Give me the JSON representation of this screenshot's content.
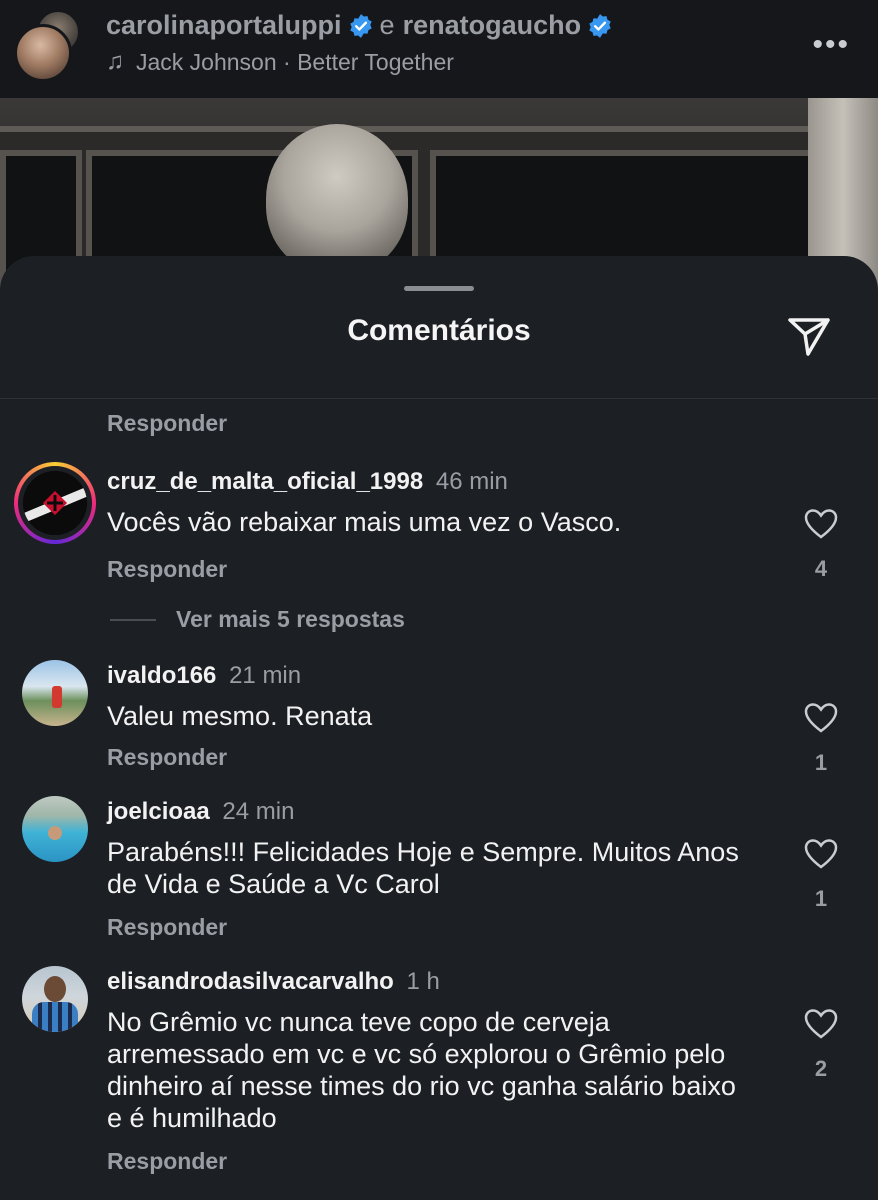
{
  "post_header": {
    "user1": "carolinaportaluppi",
    "connector": "e",
    "user2": "renatogaucho",
    "music": "Jack Johnson · Better Together",
    "more_icon": "more-horizontal-icon"
  },
  "sheet": {
    "title": "Comentários",
    "share_icon": "send-icon",
    "reply_label": "Responder"
  },
  "comments": [
    {
      "username": "cruz_de_malta_oficial_1998",
      "time": "46 min",
      "text": "Vocês vão rebaixar mais uma vez o Vasco.",
      "likes": "4",
      "reply": "Responder",
      "more_replies": "Ver mais 5 respostas"
    },
    {
      "username": "ivaldo166",
      "time": "21 min",
      "text": "Valeu mesmo.  Renata",
      "likes": "1",
      "reply": "Responder"
    },
    {
      "username": "joelcioaa",
      "time": "24 min",
      "text": "Parabéns!!! Felicidades Hoje e Sempre. Muitos Anos de Vida e Saúde a Vc Carol",
      "likes": "1",
      "reply": "Responder"
    },
    {
      "username": "elisandrodasilvacarvalho",
      "time": "1 h",
      "text": "No Grêmio vc nunca teve copo de cerveja arremessado em vc e vc só explorou o Grêmio pelo dinheiro aí nesse times do rio vc ganha salário baixo e é humilhado",
      "likes": "2",
      "reply": "Responder"
    }
  ],
  "colors": {
    "background": "#1c1f24",
    "header": "#15171b",
    "verified": "#3897f0",
    "muted_text": "#9a9ea4"
  }
}
